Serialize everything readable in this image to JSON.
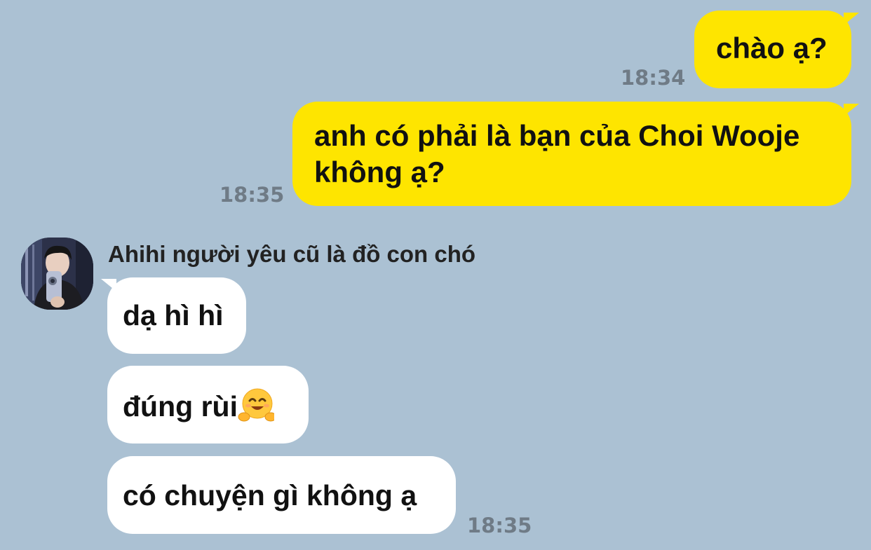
{
  "messages": {
    "out1": {
      "text": "chào ạ?",
      "time": "18:34"
    },
    "out2": {
      "text": "anh có phải là bạn của Choi Wooje không ạ?",
      "time": "18:35"
    },
    "sender": {
      "name": "Ahihi người yêu cũ là đồ con chó",
      "avatar_icon": "profile-photo"
    },
    "in1": {
      "text": "dạ hì hì"
    },
    "in2": {
      "text": "đúng rùi",
      "emoji": "hugging-face-emoji"
    },
    "in3": {
      "text": "có chuyện gì không ạ",
      "time": "18:35"
    }
  },
  "colors": {
    "background": "#abc1d3",
    "outgoing_bubble": "#fee500",
    "incoming_bubble": "#ffffff",
    "timestamp": "#6f7b86"
  }
}
